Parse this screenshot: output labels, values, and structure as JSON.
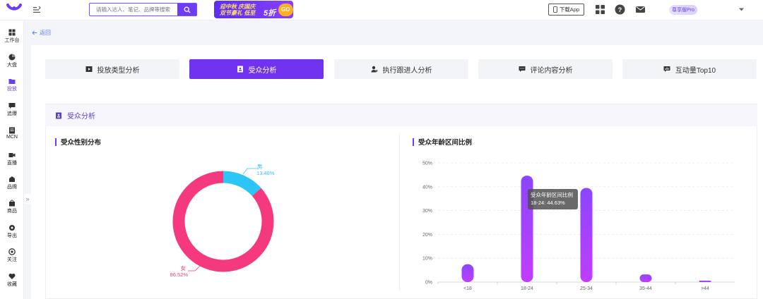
{
  "header": {
    "search_placeholder": "请输入达人、笔记、品牌等搜索",
    "promo_line1": "迎中秋 庆国庆",
    "promo_line2": "双节豪礼 低至",
    "promo_five": "5折",
    "promo_badge": "GO",
    "download_app": "下载App",
    "plan_badge": "尊享版Pro"
  },
  "sidebar": {
    "items": [
      {
        "label": "工作台",
        "icon": "grid-icon"
      },
      {
        "label": "大盘",
        "icon": "pie-icon"
      },
      {
        "label": "投放",
        "icon": "folder-icon"
      },
      {
        "label": "追爆",
        "icon": "chat-icon"
      },
      {
        "label": "MCN",
        "icon": "doc-icon"
      },
      {
        "label": "直播",
        "icon": "video-icon"
      },
      {
        "label": "品牌",
        "icon": "brand-icon"
      },
      {
        "label": "商品",
        "icon": "bag-icon"
      },
      {
        "label": "导出",
        "icon": "gear-icon"
      },
      {
        "label": "关注",
        "icon": "eye-icon"
      },
      {
        "label": "收藏",
        "icon": "heart-icon"
      }
    ],
    "active_index": 2,
    "collapse": "»"
  },
  "back_label": "返回",
  "tabs": [
    {
      "label": "投放类型分析",
      "icon": "play-folder-icon"
    },
    {
      "label": "受众分析",
      "icon": "person-doc-icon"
    },
    {
      "label": "执行跟进人分析",
      "icon": "user-cog-icon"
    },
    {
      "label": "评论内容分析",
      "icon": "comment-icon"
    },
    {
      "label": "互动量Top10",
      "icon": "chart-icon"
    }
  ],
  "active_tab": 1,
  "section_title": "受众分析",
  "gender_card": {
    "title": "受众性别分布",
    "chart_data": {
      "type": "pie",
      "categories": [
        "男",
        "女"
      ],
      "values": [
        13.48,
        86.52
      ],
      "labels": [
        "13.48%",
        "86.52%"
      ],
      "colors": [
        "#2bc6f5",
        "#f5397f"
      ]
    }
  },
  "age_card": {
    "title": "受众年龄区间比例",
    "chart_data": {
      "type": "bar",
      "categories": [
        "<18",
        "18-24",
        "25-34",
        "35-44",
        ">44"
      ],
      "values": [
        7.5,
        44.63,
        39.5,
        3.2,
        0.6
      ],
      "ylim": [
        0,
        50
      ],
      "yticks": [
        "0%",
        "10%",
        "20%",
        "30%",
        "40%",
        "50%"
      ],
      "color_top": "#8b46ff",
      "color_bottom": "#c13dff"
    },
    "tooltip": {
      "title": "受众年龄区间比例",
      "line": "18-24: 44.63%"
    }
  }
}
